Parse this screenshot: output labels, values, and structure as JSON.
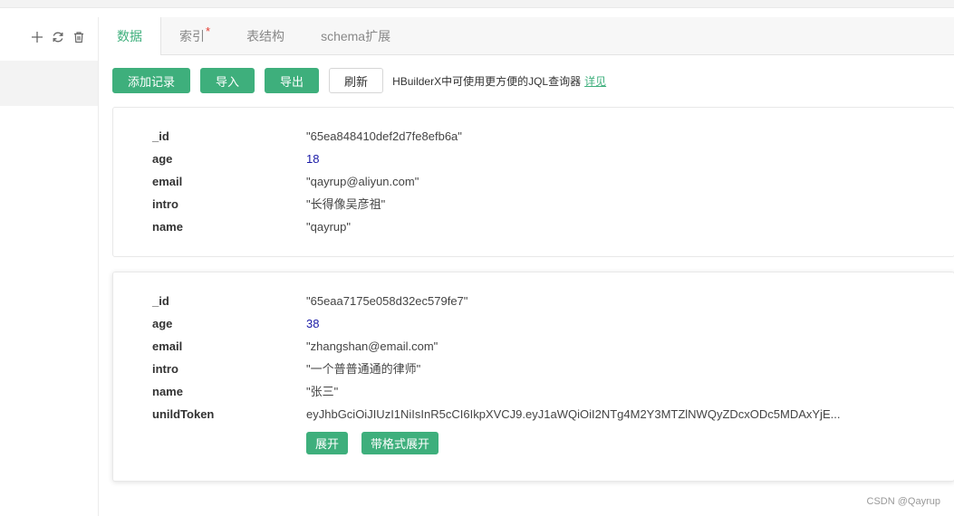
{
  "sidebar": {
    "tools": [
      "plus-icon",
      "refresh-icon",
      "trash-icon"
    ]
  },
  "tabs": [
    {
      "label": "数据",
      "active": true
    },
    {
      "label": "索引",
      "active": false,
      "marker": "*"
    },
    {
      "label": "表结构",
      "active": false
    },
    {
      "label": "schema扩展",
      "active": false
    }
  ],
  "toolbar": {
    "add_label": "添加记录",
    "import_label": "导入",
    "export_label": "导出",
    "refresh_label": "刷新",
    "hint": "HBuilderX中可使用更方便的JQL查询器",
    "hint_link": "详见"
  },
  "records": [
    {
      "fields": [
        {
          "key": "_id",
          "value": "\"65ea848410def2d7fe8efb6a\""
        },
        {
          "key": "age",
          "value": "18"
        },
        {
          "key": "email",
          "value": "\"qayrup@aliyun.com\""
        },
        {
          "key": "intro",
          "value": "\"长得像吴彦祖\""
        },
        {
          "key": "name",
          "value": "\"qayrup\""
        }
      ]
    },
    {
      "fields": [
        {
          "key": "_id",
          "value": "\"65eaa7175e058d32ec579fe7\""
        },
        {
          "key": "age",
          "value": "38"
        },
        {
          "key": "email",
          "value": "\"zhangshan@email.com\""
        },
        {
          "key": "intro",
          "value": "\"一个普普通通的律师\""
        },
        {
          "key": "name",
          "value": "\"张三\""
        },
        {
          "key": "unildToken",
          "value": "eyJhbGciOiJIUzI1NiIsInR5cCI6IkpXVCJ9.eyJ1aWQiOiI2NTg4M2Y3MTZlNWQyZDcxODc5MDAxYjE..."
        }
      ],
      "expand_label": "展开",
      "expand_formatted_label": "带格式展开"
    }
  ],
  "colors": {
    "accent": "#3eaf7c",
    "number": "#1a1aa6",
    "required_marker": "#e43d33"
  },
  "watermark": "CSDN @Qayrup"
}
